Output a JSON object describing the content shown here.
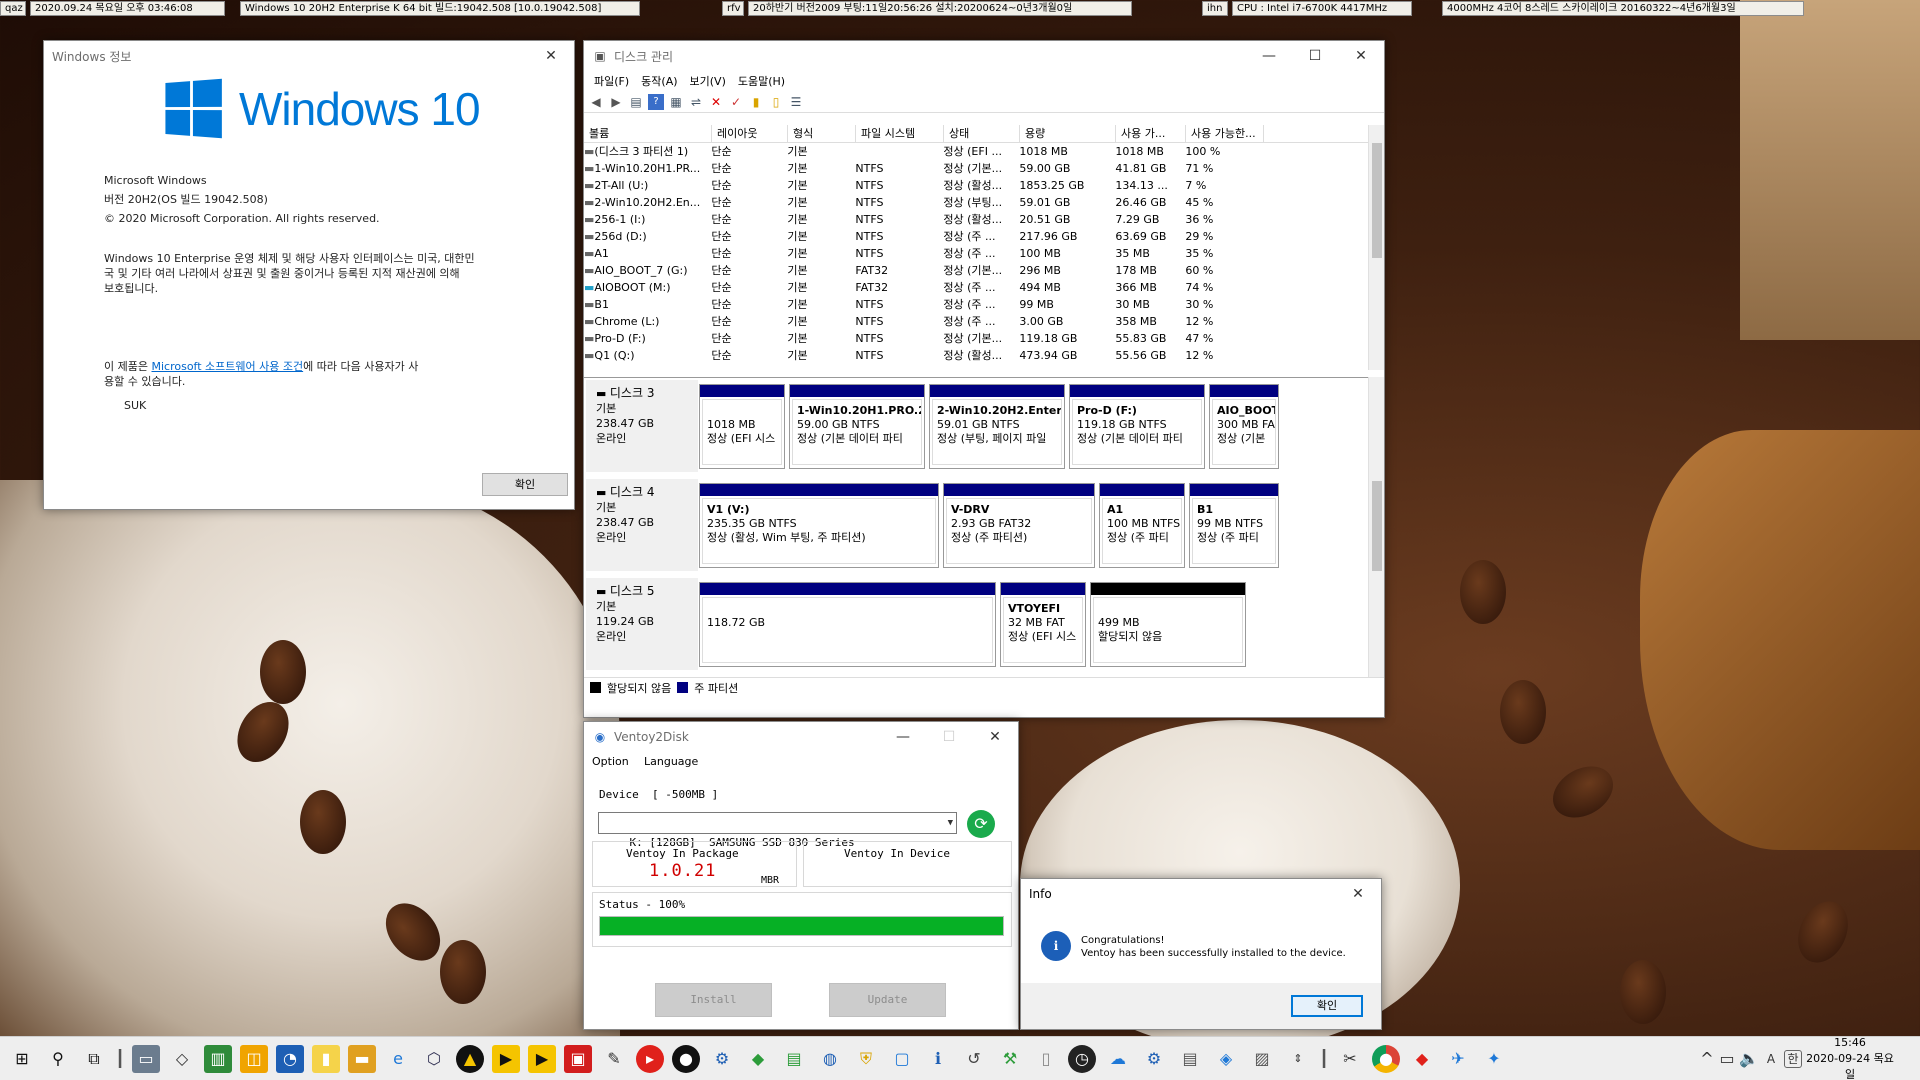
{
  "topbar": {
    "items": [
      "qaz",
      "2020.09.24 목요일 오후 03:46:08",
      "Windows 10 20H2 Enterprise K 64 bit 빌드:19042.508 [10.0.19042.508]",
      "rfv",
      "20하반기 버전2009 부팅:11일20:56:26 설치:20200624~0년3개월0일",
      "ihn",
      "CPU : Intel i7-6700K 4417MHz",
      "4000MHz 4코어 8스레드 스카이레이크 20160322~4년6개월3일"
    ]
  },
  "winver": {
    "title": "Windows 정보",
    "logo_text": "Windows 10",
    "product": "Microsoft Windows",
    "version": "버전 20H2(OS 빌드 19042.508)",
    "copyright": "© 2020 Microsoft Corporation. All rights reserved.",
    "desc1": "Windows 10 Enterprise 운영 체제 및 해당 사용자 인터페이스는 미국, 대한민",
    "desc2": "국 및 기타 여러 나라에서 상표권 및 출원 중이거나 등록된 지적 재산권에 의해",
    "desc3": "보호됩니다.",
    "license_pre": "이 제품은 ",
    "license_link": "Microsoft 소프트웨어 사용 조건",
    "license_post": "에 따라 다음 사용자가 사",
    "license_line2": "용할 수 있습니다.",
    "user": "SUK",
    "ok": "확인"
  },
  "diskmgmt": {
    "title": "디스크 관리",
    "menu": [
      "파일(F)",
      "동작(A)",
      "보기(V)",
      "도움말(H)"
    ],
    "columns": [
      "볼륨",
      "레이아웃",
      "형식",
      "파일 시스템",
      "상태",
      "용량",
      "사용 가...",
      "사용 가능한..."
    ],
    "rows": [
      [
        "(디스크 3 파티션 1)",
        "단순",
        "기본",
        "",
        "정상 (EFI ...",
        "1018 MB",
        "1018 MB",
        "100 %"
      ],
      [
        "1-Win10.20H1.PR...",
        "단순",
        "기본",
        "NTFS",
        "정상 (기본...",
        "59.00 GB",
        "41.81 GB",
        "71 %"
      ],
      [
        "2T-All (U:)",
        "단순",
        "기본",
        "NTFS",
        "정상 (활성...",
        "1853.25 GB",
        "134.13 ...",
        "7 %"
      ],
      [
        "2-Win10.20H2.En...",
        "단순",
        "기본",
        "NTFS",
        "정상 (부팅...",
        "59.01 GB",
        "26.46 GB",
        "45 %"
      ],
      [
        "256-1 (I:)",
        "단순",
        "기본",
        "NTFS",
        "정상 (활성...",
        "20.51 GB",
        "7.29 GB",
        "36 %"
      ],
      [
        "256d (D:)",
        "단순",
        "기본",
        "NTFS",
        "정상 (주 ...",
        "217.96 GB",
        "63.69 GB",
        "29 %"
      ],
      [
        "A1",
        "단순",
        "기본",
        "NTFS",
        "정상 (주 ...",
        "100 MB",
        "35 MB",
        "35 %"
      ],
      [
        "AIO_BOOT_7 (G:)",
        "단순",
        "기본",
        "FAT32",
        "정상 (기본...",
        "296 MB",
        "178 MB",
        "60 %"
      ],
      [
        "AIOBOOT (M:)",
        "단순",
        "기본",
        "FAT32",
        "정상 (주 ...",
        "494 MB",
        "366 MB",
        "74 %"
      ],
      [
        "B1",
        "단순",
        "기본",
        "NTFS",
        "정상 (주 ...",
        "99 MB",
        "30 MB",
        "30 %"
      ],
      [
        "Chrome (L:)",
        "단순",
        "기본",
        "NTFS",
        "정상 (주 ...",
        "3.00 GB",
        "358 MB",
        "12 %"
      ],
      [
        "Pro-D (F:)",
        "단순",
        "기본",
        "NTFS",
        "정상 (기본...",
        "119.18 GB",
        "55.83 GB",
        "47 %"
      ],
      [
        "Q1 (Q:)",
        "단순",
        "기본",
        "NTFS",
        "정상 (활성...",
        "473.94 GB",
        "55.56 GB",
        "12 %"
      ]
    ],
    "disks": [
      {
        "name": "디스크 3",
        "type": "기본",
        "size": "238.47 GB",
        "state": "온라인",
        "parts": [
          {
            "l1": "",
            "l2": "1018 MB",
            "l3": "정상 (EFI 시스"
          },
          {
            "l1": "1-Win10.20H1.PRO.2",
            "l2": "59.00 GB NTFS",
            "l3": "정상 (기본 데이터 파티"
          },
          {
            "l1": "2-Win10.20H2.Enterp",
            "l2": "59.01 GB NTFS",
            "l3": "정상 (부팅, 페이지 파일"
          },
          {
            "l1": "Pro-D  (F:)",
            "l2": "119.18 GB NTFS",
            "l3": "정상 (기본 데이터 파티"
          },
          {
            "l1": "AIO_BOOT",
            "l2": "300 MB FA",
            "l3": "정상 (기본"
          }
        ]
      },
      {
        "name": "디스크 4",
        "type": "기본",
        "size": "238.47 GB",
        "state": "온라인",
        "parts": [
          {
            "l1": "V1  (V:)",
            "l2": "235.35 GB NTFS",
            "l3": "정상 (활성, Wim 부팅, 주 파티션)"
          },
          {
            "l1": "V-DRV",
            "l2": "2.93 GB FAT32",
            "l3": "정상 (주 파티션)"
          },
          {
            "l1": "A1",
            "l2": "100 MB NTFS",
            "l3": "정상 (주 파티"
          },
          {
            "l1": "B1",
            "l2": "99 MB NTFS",
            "l3": "정상 (주 파티"
          }
        ]
      },
      {
        "name": "디스크 5",
        "type": "기본",
        "size": "119.24 GB",
        "state": "온라인",
        "parts": [
          {
            "l1": "",
            "l2": "118.72 GB",
            "l3": ""
          },
          {
            "l1": "VTOYEFI",
            "l2": "32 MB FAT",
            "l3": "정상 (EFI 시스"
          },
          {
            "l1": "",
            "l2": "499 MB",
            "l3": "할당되지 않음"
          }
        ]
      }
    ],
    "legend_unalloc": "할당되지 않음",
    "legend_primary": "주 파티션"
  },
  "ventoy": {
    "title": "Ventoy2Disk",
    "menu_option": "Option",
    "menu_language": "Language",
    "device_label": "Device  [ -500MB ]",
    "device_value": "K: [128GB]  SAMSUNG SSD 830 Series",
    "pkg_label": "Ventoy In Package",
    "pkg_version": "1.0.21",
    "pkg_style": "MBR",
    "dev_label": "Ventoy In Device",
    "status": "Status - 100%",
    "progress": 1.0,
    "install": "Install",
    "update": "Update"
  },
  "info": {
    "title": "Info",
    "line1": "Congratulations!",
    "line2": "Ventoy has been successfully installed to the device.",
    "ok": "확인"
  },
  "taskbar": {
    "time": "15:46",
    "date": "2020-09-24 목요일",
    "ime1": "A",
    "ime2": "한"
  },
  "colors": {
    "accent": "#0078d7",
    "primary_partition": "#000080",
    "progress": "#06b025",
    "ventoy_version": "#d00000"
  }
}
